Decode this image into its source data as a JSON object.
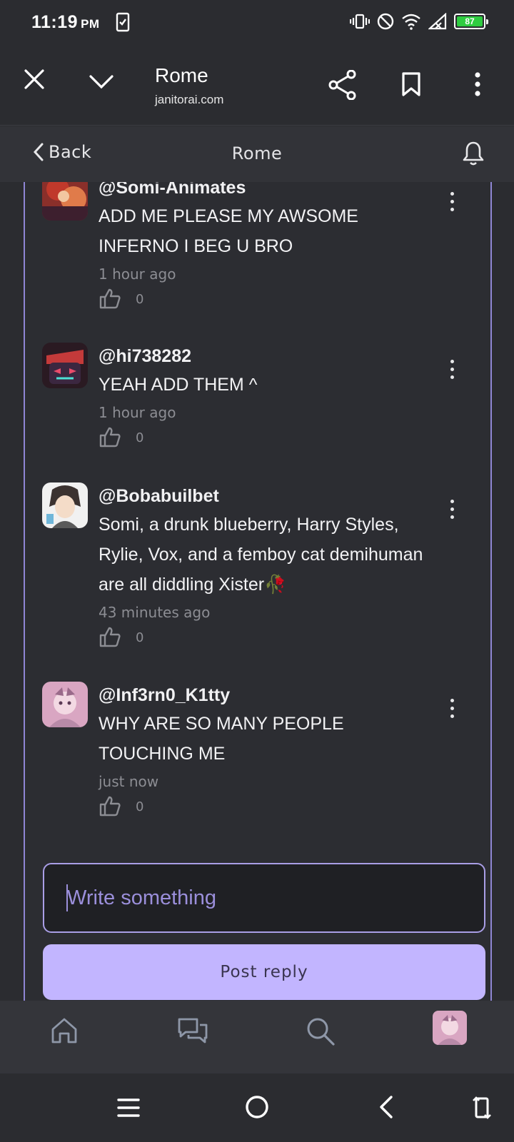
{
  "status_bar": {
    "time": "11:19",
    "ampm": "PM",
    "battery": "87",
    "battery_color": "#2ecc40"
  },
  "browser": {
    "page_title": "Rome",
    "url": "janitorai.com",
    "icons": [
      "close-icon",
      "chevron-down-icon",
      "share-icon",
      "bookmark-icon",
      "more-vert-icon"
    ]
  },
  "header": {
    "back_label": "Back",
    "title": "Rome"
  },
  "comments": [
    {
      "username": "@Somi-Animates",
      "text": "ADD ME PLEASE MY AWSOME INFERNO I BEG U BRO",
      "time": "1 hour ago",
      "likes": "0"
    },
    {
      "username": "@hi738282",
      "text": "YEAH ADD THEM ^",
      "time": "1 hour ago",
      "likes": "0"
    },
    {
      "username": "@Bobabuilbet",
      "text": "Somi, a drunk blueberry, Harry Styles, Rylie, Vox, and a femboy cat demihuman are all diddling Xister🥀",
      "time": "43 minutes ago",
      "likes": "0"
    },
    {
      "username": "@Inf3rn0_K1tty",
      "text": "WHY ARE SO MANY PEOPLE TOUCHING ME",
      "time": "just now",
      "likes": "0"
    }
  ],
  "reply": {
    "placeholder": "Write something",
    "post_label": "Post reply"
  },
  "colors": {
    "accent": "#c2b5ff",
    "panel_border": "#8f86d4",
    "background": "#2b2c30"
  }
}
